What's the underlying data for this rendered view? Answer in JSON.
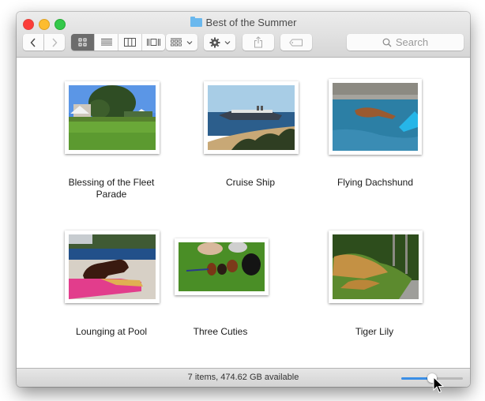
{
  "window": {
    "title": "Best of the Summer",
    "folder_icon": "folder-icon",
    "accent_color": "#3a8ee6"
  },
  "toolbar": {
    "back_icon": "chevron-left-icon",
    "forward_icon": "chevron-right-icon",
    "view_modes": [
      {
        "name": "icon-view",
        "icon": "grid-icon",
        "active": true
      },
      {
        "name": "list-view",
        "icon": "list-icon",
        "active": false
      },
      {
        "name": "column-view",
        "icon": "columns-icon",
        "active": false
      },
      {
        "name": "cover-flow-view",
        "icon": "coverflow-icon",
        "active": false
      }
    ],
    "arrange_icon": "arrange-grid-icon",
    "action_icon": "gear-icon",
    "share_icon": "share-icon",
    "tag_icon": "tag-icon",
    "search": {
      "placeholder": "Search",
      "value": ""
    }
  },
  "items": [
    {
      "name": "Blessing of the Fleet Parade",
      "line1": "Blessing of the Fleet",
      "line2": "Parade"
    },
    {
      "name": "Cruise Ship",
      "line1": "Cruise Ship",
      "line2": ""
    },
    {
      "name": "Flying Dachshund",
      "line1": "Flying Dachshund",
      "line2": ""
    },
    {
      "name": "Lounging at Pool",
      "line1": "Lounging at Pool",
      "line2": ""
    },
    {
      "name": "Three Cuties",
      "line1": "Three Cuties",
      "line2": ""
    },
    {
      "name": "Tiger Lily",
      "line1": "Tiger Lily",
      "line2": ""
    }
  ],
  "status": {
    "text": "7 items, 474.62 GB available",
    "icon_size_slider": 0.5
  }
}
